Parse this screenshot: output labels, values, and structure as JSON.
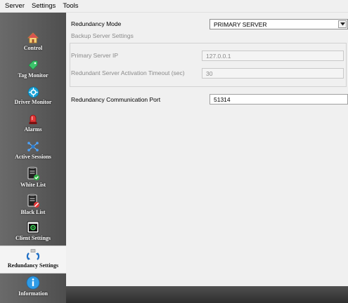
{
  "menu": [
    "Server",
    "Settings",
    "Tools"
  ],
  "sidebar": {
    "items": [
      {
        "label": "Control",
        "icon": "home-icon"
      },
      {
        "label": "Tag Monitor",
        "icon": "tag-icon"
      },
      {
        "label": "Driver Monitor",
        "icon": "driver-icon"
      },
      {
        "label": "Alarms",
        "icon": "alarm-light-icon"
      },
      {
        "label": "Active Sessions",
        "icon": "network-icon"
      },
      {
        "label": "White List",
        "icon": "clipboard-check-icon"
      },
      {
        "label": "Black List",
        "icon": "clipboard-block-icon"
      },
      {
        "label": "Client Settings",
        "icon": "client-window-icon"
      },
      {
        "label": "Redundancy Settings",
        "icon": "redundancy-icon",
        "active": true
      },
      {
        "label": "Information",
        "icon": "info-icon"
      }
    ]
  },
  "form": {
    "redundancy_mode_label": "Redundancy Mode",
    "redundancy_mode_value": "PRIMARY SERVER",
    "backup_header": "Backup Server Settings",
    "primary_ip_label": "Primary Server IP",
    "primary_ip_value": "127.0.0.1",
    "timeout_label": "Redundant Server Activation Timeout (sec)",
    "timeout_value": "30",
    "comm_port_label": "Redundancy Communication Port",
    "comm_port_value": "51314"
  },
  "colors": {
    "sidebar_bg": "#5a5a5a",
    "active_item_bg": "#f4f4f4",
    "bottom_bar": "#3a3a3a"
  }
}
